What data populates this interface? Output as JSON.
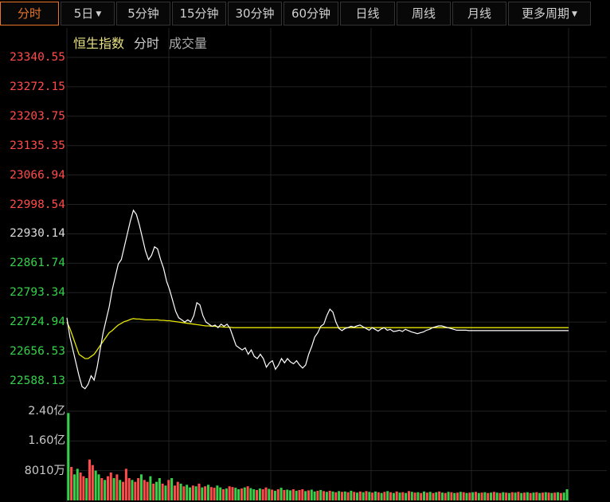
{
  "tabs": [
    {
      "label": "分时",
      "active": true,
      "caret": false
    },
    {
      "label": "5日",
      "active": false,
      "caret": true
    },
    {
      "label": "5分钟",
      "active": false,
      "caret": false
    },
    {
      "label": "15分钟",
      "active": false,
      "caret": false
    },
    {
      "label": "30分钟",
      "active": false,
      "caret": false
    },
    {
      "label": "60分钟",
      "active": false,
      "caret": false
    },
    {
      "label": "日线",
      "active": false,
      "caret": false
    },
    {
      "label": "周线",
      "active": false,
      "caret": false
    },
    {
      "label": "月线",
      "active": false,
      "caret": false
    },
    {
      "label": "更多周期",
      "active": false,
      "caret": true
    }
  ],
  "caret_symbol": "▼",
  "legend": {
    "index_name": "恒生指数",
    "mode": "分时",
    "volume": "成交量"
  },
  "colors": {
    "accent": "#e8742a",
    "price_line": "#ffffff",
    "avg_line": "#e6e600",
    "up": "#ff4b4b",
    "down": "#35d14a",
    "flat": "#dcdcdc",
    "grid": "#222222"
  },
  "chart_data": [
    {
      "type": "line",
      "y_tick_labels": [
        "23340.55",
        "23272.15",
        "23203.75",
        "23135.35",
        "23066.94",
        "22998.54",
        "22930.14",
        "22861.74",
        "22793.34",
        "22724.94",
        "22656.53",
        "22588.13"
      ],
      "y_ticks": [
        23340.55,
        23272.15,
        23203.75,
        23135.35,
        23066.94,
        22998.54,
        22930.14,
        22861.74,
        22793.34,
        22724.94,
        22656.53,
        22588.13
      ],
      "prev_close": 22930.14,
      "ylim": [
        22588.13,
        23340.55
      ],
      "x": [
        0,
        2,
        4,
        6,
        8,
        10,
        12,
        14,
        16,
        18,
        20,
        22,
        24,
        26,
        28,
        30,
        32,
        34,
        36,
        38,
        40,
        42,
        44,
        46,
        48,
        50,
        52,
        54,
        56,
        58,
        60,
        62,
        64,
        66,
        68,
        70,
        72,
        74,
        76,
        78,
        80,
        82,
        84,
        86,
        88,
        90,
        92,
        94,
        96,
        98,
        100,
        102,
        104,
        106,
        108,
        110,
        112,
        114,
        116,
        118,
        120,
        122,
        124,
        126,
        128,
        130,
        132,
        134,
        136,
        138,
        140,
        142,
        144,
        146,
        148,
        150,
        152,
        154,
        156,
        158,
        160,
        162,
        164,
        166,
        168,
        170,
        172,
        174,
        176,
        178,
        180,
        182,
        184,
        186,
        188,
        190,
        192,
        194,
        196,
        198,
        200,
        202,
        204,
        206,
        208,
        210,
        212,
        214,
        216,
        218,
        220,
        222,
        224,
        226,
        228,
        230,
        232,
        234,
        236,
        238,
        240,
        242,
        244,
        246,
        248,
        250,
        252,
        254,
        256,
        258,
        260,
        262,
        264,
        266,
        268,
        270,
        272,
        274,
        276,
        278,
        280,
        282,
        284,
        286,
        288,
        290,
        292,
        294,
        296,
        298,
        300,
        302,
        304,
        306,
        308,
        310,
        312,
        314,
        316,
        318,
        320,
        322,
        324,
        326,
        328,
        330,
        332
      ],
      "series": [
        {
          "values": [
            22735,
            22690,
            22660,
            22630,
            22600,
            22575,
            22570,
            22580,
            22600,
            22590,
            22620,
            22660,
            22700,
            22730,
            22760,
            22800,
            22830,
            22860,
            22870,
            22900,
            22930,
            22960,
            22985,
            22975,
            22950,
            22920,
            22890,
            22870,
            22880,
            22900,
            22895,
            22870,
            22850,
            22820,
            22800,
            22775,
            22750,
            22735,
            22730,
            22725,
            22730,
            22725,
            22740,
            22770,
            22765,
            22740,
            22725,
            22720,
            22715,
            22718,
            22712,
            22720,
            22715,
            22720,
            22710,
            22690,
            22670,
            22665,
            22660,
            22665,
            22650,
            22660,
            22645,
            22640,
            22650,
            22640,
            22620,
            22630,
            22635,
            22615,
            22625,
            22640,
            22630,
            22640,
            22632,
            22628,
            22635,
            22625,
            22618,
            22625,
            22650,
            22668,
            22690,
            22700,
            22715,
            22720,
            22740,
            22755,
            22748,
            22725,
            22710,
            22705,
            22710,
            22712,
            22715,
            22713,
            22716,
            22718,
            22714,
            22710,
            22706,
            22712,
            22708,
            22704,
            22709,
            22712,
            22706,
            22708,
            22703,
            22704,
            22706,
            22703,
            22708,
            22705,
            22702,
            22700,
            22698,
            22700,
            22702,
            22706,
            22708,
            22712,
            22714,
            22716,
            22716,
            22714,
            22712,
            22710,
            22708,
            22706,
            22706,
            22706,
            22706,
            22705,
            22705,
            22705,
            22705,
            22705,
            22705,
            22705,
            22705,
            22705,
            22705,
            22705,
            22705,
            22705,
            22705,
            22705,
            22705,
            22705,
            22705,
            22705,
            22705,
            22705,
            22705,
            22705,
            22705,
            22705,
            22705,
            22705,
            22705,
            22705,
            22705,
            22705,
            22705,
            22705,
            22705
          ]
        },
        {
          "values": [
            22725,
            22710,
            22690,
            22670,
            22650,
            22645,
            22640,
            22640,
            22645,
            22650,
            22660,
            22670,
            22680,
            22690,
            22700,
            22705,
            22712,
            22718,
            22722,
            22726,
            22728,
            22731,
            22733,
            22732,
            22732,
            22731,
            22730,
            22730,
            22730,
            22730,
            22730,
            22729,
            22729,
            22728,
            22728,
            22727,
            22726,
            22725,
            22724,
            22723,
            22722,
            22721,
            22720,
            22719,
            22718,
            22717,
            22716,
            22716,
            22715,
            22715,
            22714,
            22714,
            22713,
            22713,
            22713,
            22712,
            22712,
            22712,
            22712,
            22712,
            22712,
            22712,
            22712,
            22712,
            22712,
            22712,
            22712,
            22712,
            22712,
            22712,
            22712,
            22712,
            22712,
            22712,
            22712,
            22712,
            22712,
            22712,
            22712,
            22712,
            22712,
            22712,
            22712,
            22712,
            22712,
            22712,
            22712,
            22712,
            22712,
            22712,
            22712,
            22712,
            22712,
            22712,
            22712,
            22712,
            22712,
            22712,
            22712,
            22712,
            22712,
            22712,
            22712,
            22712,
            22712,
            22712,
            22712,
            22712,
            22712,
            22712,
            22712,
            22712,
            22712,
            22712,
            22712,
            22712,
            22712,
            22712,
            22712,
            22712,
            22712,
            22712,
            22712,
            22712,
            22712,
            22712,
            22712,
            22712,
            22712,
            22712,
            22712,
            22712,
            22712,
            22712,
            22712,
            22712,
            22712,
            22712,
            22712,
            22712,
            22712,
            22712,
            22712,
            22712,
            22712,
            22712,
            22712,
            22712,
            22712,
            22712,
            22712,
            22712,
            22712,
            22712,
            22712,
            22712,
            22712,
            22712,
            22712,
            22712,
            22712,
            22712,
            22712,
            22712,
            22712,
            22712,
            22712
          ]
        }
      ]
    },
    {
      "type": "bar",
      "y_tick_labels": [
        "2.40亿",
        "1.60亿",
        "8010万"
      ],
      "y_ticks": [
        240000000,
        160000000,
        80100000
      ],
      "ylim": [
        0,
        240000000
      ],
      "values": [
        235000000,
        90000000,
        70000000,
        85000000,
        75000000,
        65000000,
        60000000,
        110000000,
        95000000,
        80000000,
        70000000,
        60000000,
        55000000,
        65000000,
        75000000,
        60000000,
        70000000,
        55000000,
        50000000,
        85000000,
        60000000,
        55000000,
        50000000,
        60000000,
        70000000,
        55000000,
        50000000,
        65000000,
        45000000,
        50000000,
        60000000,
        45000000,
        40000000,
        55000000,
        60000000,
        40000000,
        50000000,
        45000000,
        38000000,
        42000000,
        35000000,
        40000000,
        38000000,
        45000000,
        35000000,
        38000000,
        42000000,
        36000000,
        34000000,
        40000000,
        35000000,
        30000000,
        32000000,
        38000000,
        36000000,
        34000000,
        30000000,
        32000000,
        35000000,
        38000000,
        33000000,
        30000000,
        28000000,
        32000000,
        30000000,
        35000000,
        31000000,
        29000000,
        26000000,
        30000000,
        34000000,
        28000000,
        29000000,
        27000000,
        30000000,
        26000000,
        28000000,
        30000000,
        25000000,
        27000000,
        29000000,
        24000000,
        26000000,
        28000000,
        25000000,
        23000000,
        26000000,
        24000000,
        22000000,
        25000000,
        23000000,
        24000000,
        22000000,
        26000000,
        23000000,
        21000000,
        24000000,
        22000000,
        25000000,
        23000000,
        21000000,
        24000000,
        22000000,
        20000000,
        23000000,
        25000000,
        22000000,
        20000000,
        24000000,
        21000000,
        22000000,
        20000000,
        25000000,
        23000000,
        21000000,
        22000000,
        20000000,
        24000000,
        21000000,
        23000000,
        20000000,
        22000000,
        24000000,
        21000000,
        20000000,
        23000000,
        22000000,
        20000000,
        21000000,
        23000000,
        22000000,
        20000000,
        21000000,
        22000000,
        23000000,
        20000000,
        21000000,
        22000000,
        20000000,
        21000000,
        23000000,
        21000000,
        20000000,
        22000000,
        21000000,
        20000000,
        22000000,
        21000000,
        23000000,
        20000000,
        21000000,
        22000000,
        20000000,
        21000000,
        22000000,
        20000000,
        21000000,
        22000000,
        21000000,
        20000000,
        21000000,
        22000000,
        20000000,
        21000000,
        30000000
      ],
      "bar_colors": [
        "down",
        "up",
        "down",
        "down",
        "up",
        "up",
        "down",
        "up",
        "up",
        "down",
        "down",
        "up",
        "down",
        "up",
        "up",
        "down",
        "up",
        "down",
        "up",
        "up",
        "up",
        "down",
        "up",
        "up",
        "down",
        "up",
        "up",
        "down",
        "up",
        "down",
        "down",
        "up",
        "down",
        "up",
        "down",
        "up",
        "up",
        "down",
        "up",
        "down",
        "down",
        "up",
        "down",
        "up",
        "down",
        "up",
        "down",
        "up",
        "up",
        "down",
        "down",
        "up",
        "down",
        "up",
        "up",
        "down",
        "down",
        "up",
        "down",
        "up",
        "down",
        "down",
        "up",
        "down",
        "up",
        "up",
        "down",
        "up",
        "down",
        "up",
        "down",
        "up",
        "down",
        "down",
        "up",
        "down",
        "up",
        "up",
        "down",
        "up",
        "down",
        "down",
        "up",
        "down",
        "up",
        "down",
        "up",
        "down",
        "up",
        "down",
        "up",
        "down",
        "up",
        "down",
        "up",
        "down",
        "up",
        "down",
        "up",
        "down",
        "up",
        "down",
        "up",
        "down",
        "up",
        "down",
        "up",
        "down",
        "up",
        "down",
        "up",
        "down",
        "up",
        "down",
        "up",
        "down",
        "up",
        "down",
        "up",
        "down",
        "up",
        "down",
        "up",
        "down",
        "up",
        "down",
        "up",
        "down",
        "up",
        "down",
        "up",
        "down",
        "up",
        "down",
        "up",
        "down",
        "up",
        "down",
        "up",
        "down",
        "up",
        "down",
        "up",
        "down",
        "up",
        "down",
        "up",
        "down",
        "up",
        "down",
        "up",
        "down",
        "up",
        "down",
        "up",
        "down",
        "up",
        "down",
        "up",
        "down",
        "up",
        "down",
        "up",
        "down",
        "down"
      ]
    }
  ]
}
